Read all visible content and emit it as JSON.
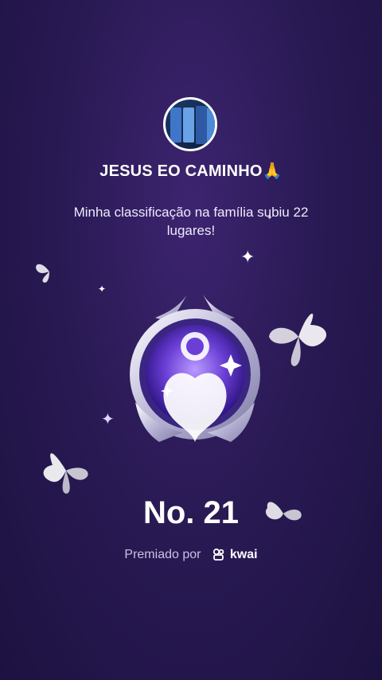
{
  "profile": {
    "name": "JESUS EO CAMINHO🙏",
    "avatar_icon": "avatar-image"
  },
  "message": "Minha classificação na família subiu 22 lugares!",
  "rank": "No. 21",
  "award": {
    "prefix": "Premiado por",
    "brand": "kwai",
    "brand_icon": "kwai-logo-icon"
  },
  "colors": {
    "background": "#2a1a55",
    "badge_purple": "#6b3fd6",
    "text_muted": "#c9c1e3"
  }
}
